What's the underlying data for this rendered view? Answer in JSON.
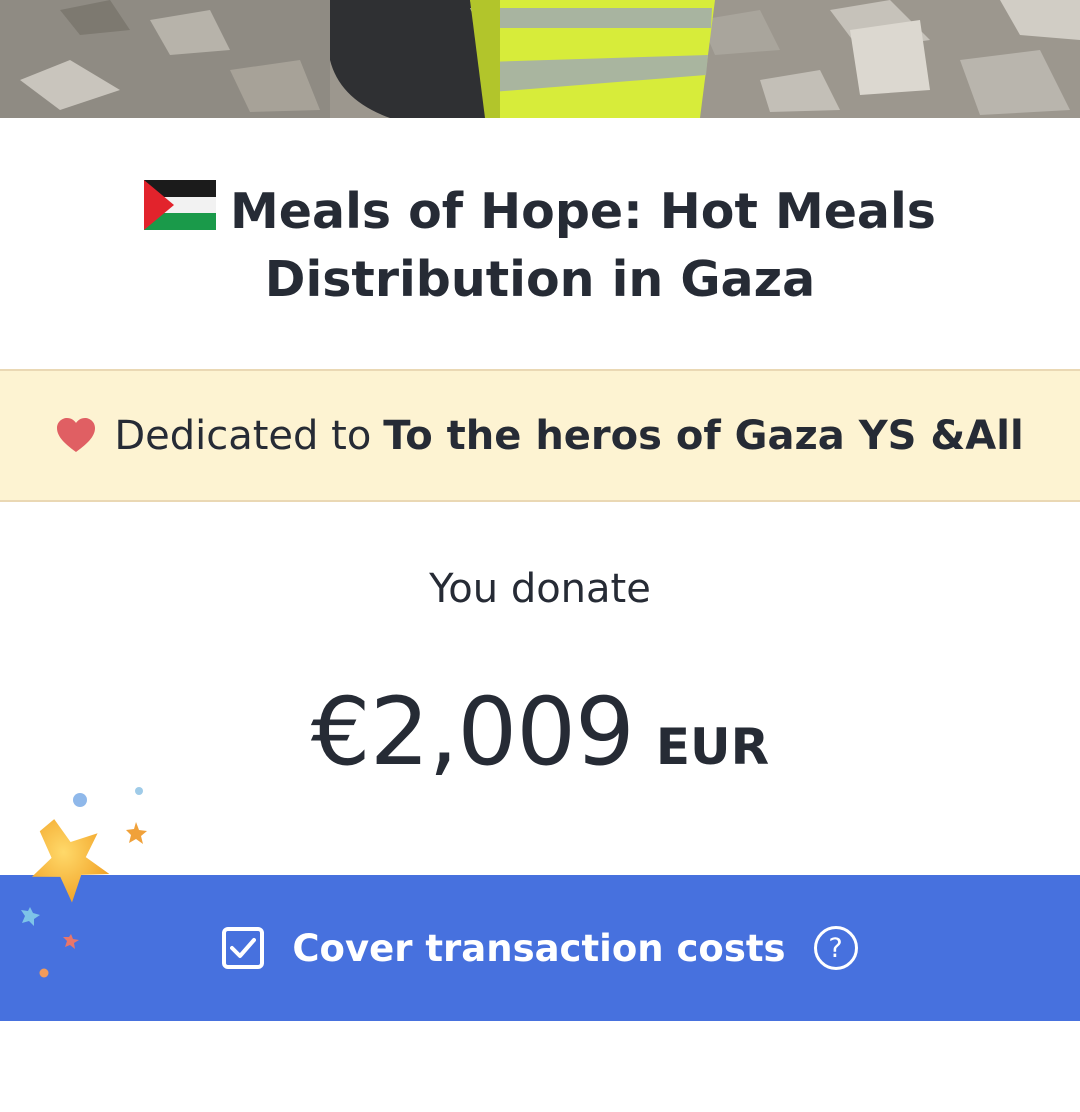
{
  "campaign": {
    "title_line1": "Meals of Hope: Hot Meals",
    "title_line2": "Distribution in Gaza",
    "flag_icon": "palestine-flag-icon"
  },
  "dedication": {
    "prefix": "Dedicated to",
    "name": "To the heros of Gaza YS &All",
    "icon": "heart-icon",
    "background": "#fdf3d2"
  },
  "donation": {
    "label": "You donate",
    "amount": "€2,009",
    "currency": "EUR"
  },
  "cover_costs": {
    "label": "Cover transaction costs",
    "checked": true,
    "help_symbol": "?",
    "background": "#4771de"
  },
  "colors": {
    "accent": "#4771de",
    "text": "#262b35",
    "heart": "#e05f63"
  }
}
